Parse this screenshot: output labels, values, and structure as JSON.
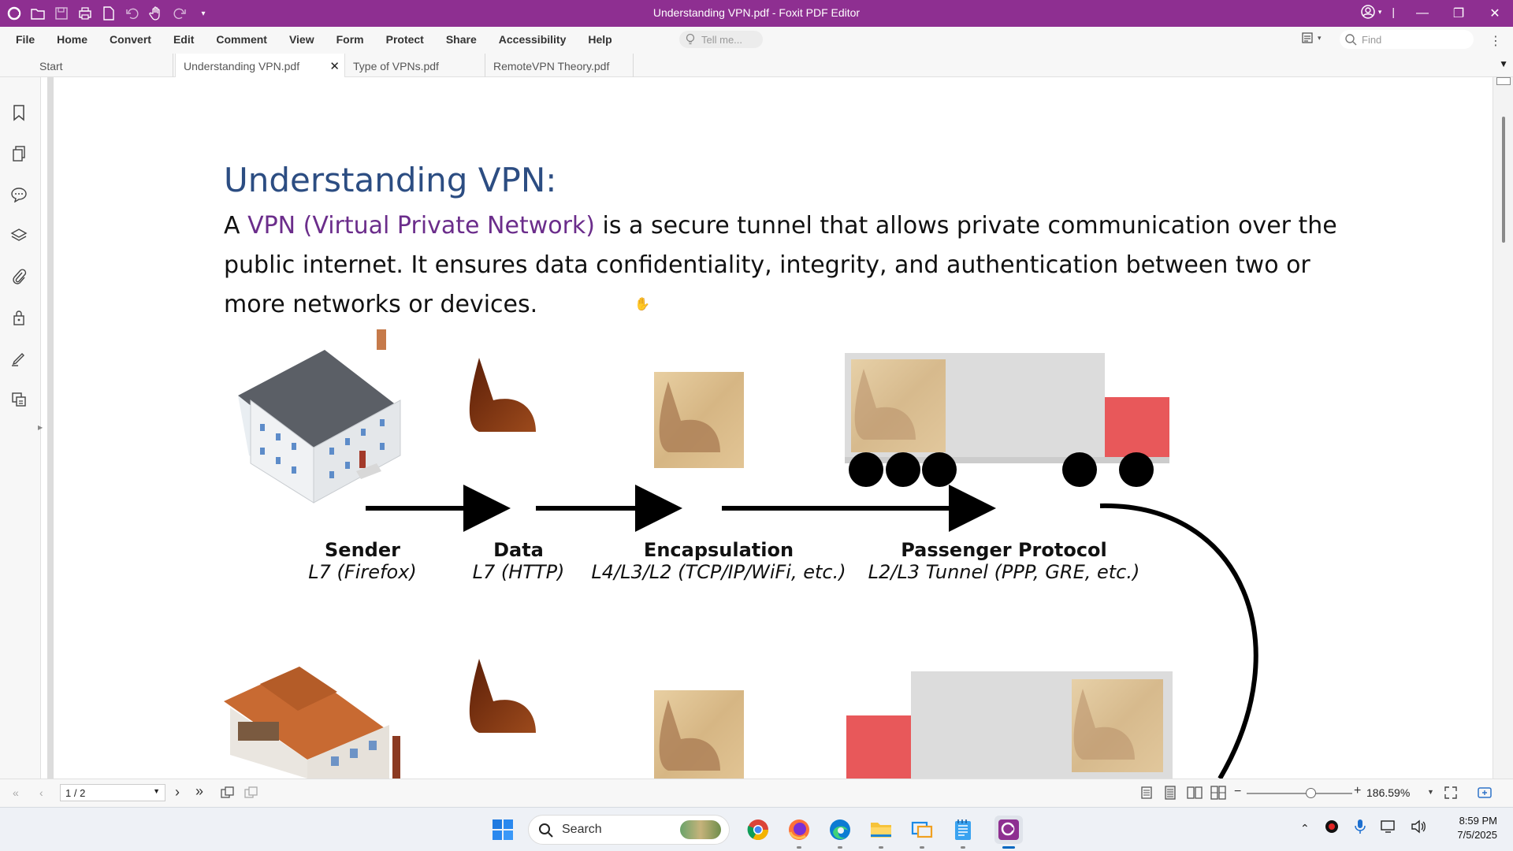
{
  "window": {
    "title": "Understanding VPN.pdf - Foxit PDF Editor",
    "controls": [
      "minimize",
      "restore",
      "close"
    ]
  },
  "quick_access": [
    "app-logo-icon",
    "open-icon",
    "save-icon",
    "print-icon",
    "new-icon",
    "undo-icon",
    "hand-tool-icon",
    "redo-icon",
    "customize-icon"
  ],
  "menu": [
    "File",
    "Home",
    "Convert",
    "Edit",
    "Comment",
    "View",
    "Form",
    "Protect",
    "Share",
    "Accessibility",
    "Help"
  ],
  "tell_me": {
    "placeholder": "Tell me..."
  },
  "find": {
    "placeholder": "Find"
  },
  "tabs": [
    {
      "label": "Start",
      "active": false
    },
    {
      "label": "Understanding VPN.pdf",
      "active": true
    },
    {
      "label": "Type of VPNs.pdf",
      "active": false
    },
    {
      "label": "RemoteVPN Theory.pdf",
      "active": false
    }
  ],
  "left_nav": [
    "bookmark-icon",
    "pages-icon",
    "comments-icon",
    "layers-icon",
    "attachments-icon",
    "security-icon",
    "signature-icon",
    "compare-icon"
  ],
  "document": {
    "heading": "Understanding VPN:",
    "para_prefix": "A ",
    "para_highlight": "VPN (Virtual Private Network)",
    "para_rest": " is a secure tunnel that allows private communication over the public internet. It ensures data confidentiality, integrity, and authentication between two or more networks or devices.",
    "diagram": {
      "stages": [
        {
          "title": "Sender",
          "subtitle": "L7 (Firefox)"
        },
        {
          "title": "Data",
          "subtitle": "L7 (HTTP)"
        },
        {
          "title": "Encapsulation",
          "subtitle": "L4/L3/L2 (TCP/IP/WiFi, etc.)"
        },
        {
          "title": "Passenger Protocol",
          "subtitle": "L2/L3 Tunnel (PPP, GRE, etc.)"
        }
      ],
      "colors": {
        "data_shape": "#7a2e0e",
        "box": "#d9bb8c",
        "truck_body": "#dcdcdc",
        "truck_cab": "#e8585a",
        "roof": "#555a60",
        "roof2": "#c86a32"
      }
    }
  },
  "status": {
    "page_indicator": "1 / 2",
    "zoom": "186.59%"
  },
  "taskbar": {
    "search_label": "Search",
    "apps": [
      "chrome-icon",
      "firefox-icon",
      "edge-icon",
      "file-explorer-icon",
      "remote-desktop-icon",
      "notepad-icon",
      "foxit-pdf-icon"
    ],
    "time": "8:59 PM",
    "date": "7/5/2025"
  }
}
